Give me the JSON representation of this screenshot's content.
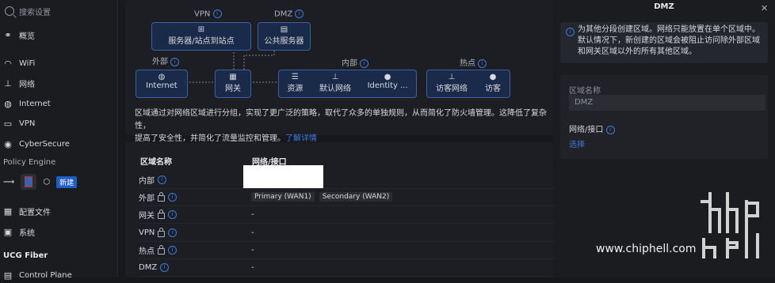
{
  "sidebar": {
    "search_placeholder": "搜索设置",
    "items": [
      {
        "label": "概览",
        "icon": "binoculars-icon"
      },
      {
        "label": "WiFi",
        "icon": "wifi-icon"
      },
      {
        "label": "网络",
        "icon": "network-icon"
      },
      {
        "label": "Internet",
        "icon": "globe-icon"
      },
      {
        "label": "VPN",
        "icon": "vpn-icon"
      },
      {
        "label": "CyberSecure",
        "icon": "shield-icon"
      }
    ],
    "policy_engine_label": "Policy Engine",
    "policy_new_badge": "新建",
    "items2": [
      {
        "label": "配置文件",
        "icon": "profile-icon"
      },
      {
        "label": "系统",
        "icon": "system-icon"
      }
    ],
    "section_ucg": "UCG Fiber",
    "control_plane": "Control Plane"
  },
  "diagram": {
    "vpn_label": "VPN",
    "dmz_label": "DMZ",
    "vpn_node": "服务器/站点到站点",
    "dmz_node": "公共服务器",
    "external_label": "外部",
    "internal_label": "内部",
    "hotspot_label": "热点",
    "internet_node": "Internet",
    "gateway_node": "网关",
    "internal_items": [
      "资源",
      "默认网络",
      "Identity ..."
    ],
    "hotspot_items": [
      "访客网络",
      "访客"
    ]
  },
  "description": {
    "text": "区域通过对网络区域进行分组，实现了更广泛的策略，取代了众多的单独规则，从而简化了防火墙管理。这降低了复杂性，",
    "text2": "提高了安全性，并简化了流量监控和管理。",
    "link": "了解详情"
  },
  "table": {
    "col_name": "区域名称",
    "col_network": "网络/接口",
    "rows": [
      {
        "name": "内部",
        "locked": false,
        "networks": []
      },
      {
        "name": "外部",
        "locked": true,
        "networks": [
          "Primary (WAN1)",
          "Secondary (WAN2)"
        ]
      },
      {
        "name": "网关",
        "locked": true,
        "networks": [
          "-"
        ]
      },
      {
        "name": "VPN",
        "locked": true,
        "networks": [
          "-"
        ]
      },
      {
        "name": "热点",
        "locked": true,
        "networks": [
          "-"
        ]
      },
      {
        "name": "DMZ",
        "locked": false,
        "networks": [
          "-"
        ]
      }
    ]
  },
  "panel": {
    "title": "DMZ",
    "notice": "为其他分段创建区域。网络只能放置在单个区域中。默认情况下，新创建的区域会被阻止访问除外部区域和网关区域以外的所有其他区域。",
    "zone_name_label": "区域名称",
    "zone_name_value": "DMZ",
    "network_label": "网络/接口",
    "select_link": "选择"
  },
  "watermark": {
    "site": "www.chiphell.com"
  },
  "colors": {
    "accent": "#3d7ae4",
    "background": "#17181c"
  }
}
